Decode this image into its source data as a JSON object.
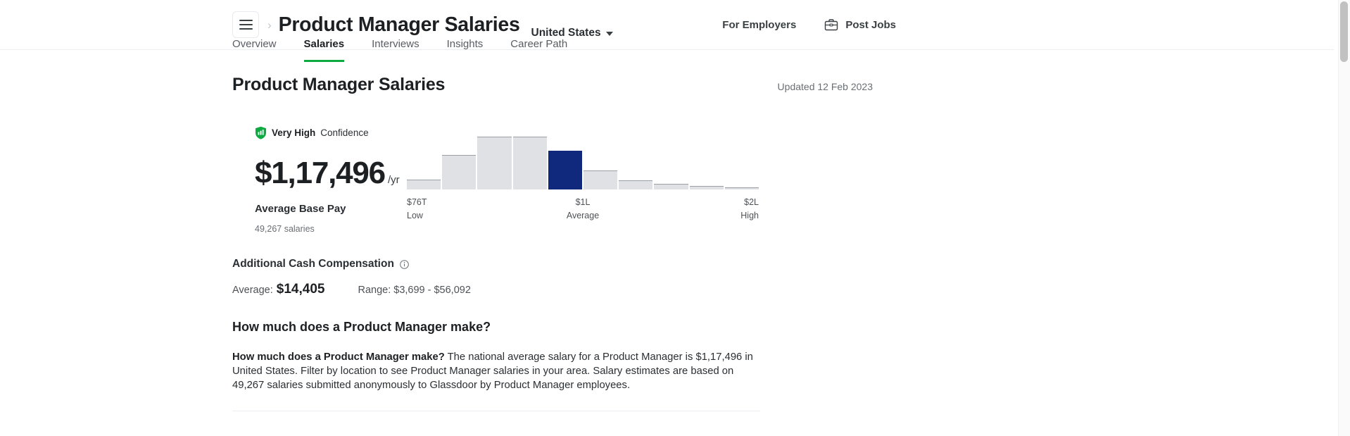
{
  "header": {
    "menu_icon": "hamburger-icon",
    "breadcrumb_chevron": "chevron-right-icon",
    "title": "Product Manager Salaries",
    "location": "United States",
    "location_caret": "chevron-down-icon",
    "for_employers": "For Employers",
    "post_jobs": "Post Jobs",
    "post_jobs_icon": "briefcase-icon"
  },
  "tabs": [
    {
      "label": "Overview",
      "active": false
    },
    {
      "label": "Salaries",
      "active": true
    },
    {
      "label": "Interviews",
      "active": false
    },
    {
      "label": "Insights",
      "active": false
    },
    {
      "label": "Career Path",
      "active": false
    }
  ],
  "main": {
    "section_title": "Product Manager Salaries",
    "updated": "Updated 12 Feb 2023",
    "confidence": {
      "icon": "shield-bars-icon",
      "level": "Very High",
      "suffix": "Confidence"
    },
    "pay": {
      "amount": "$1,17,496",
      "period": "/yr",
      "label": "Average Base Pay",
      "count": "49,267 salaries"
    },
    "cash": {
      "title": "Additional Cash Compensation",
      "info_icon": "info-circle-icon",
      "average_label": "Average:",
      "average_value": "$14,405",
      "range": "Range: $3,699 - $56,092"
    },
    "faq": {
      "heading": "How much does a Product Manager make?",
      "question_inline": "How much does a Product Manager make?",
      "answer": " The national average salary for a Product Manager is $1,17,496 in United States. Filter by location to see Product Manager salaries in your area. Salary estimates are based on 49,267 salaries submitted anonymously to Glassdoor by Product Manager employees."
    }
  },
  "colors": {
    "accent_green": "#0caa41",
    "highlight_bar": "#10297d",
    "bar_grey": "#dfe1e4",
    "bar_top_border": "#9aa0a6"
  },
  "chart_data": {
    "type": "bar",
    "title": "Product Manager base pay distribution",
    "xlabel": "",
    "ylabel": "",
    "grid": false,
    "legend": false,
    "categories": [
      "b1",
      "b2",
      "b3",
      "b4",
      "b5",
      "b6",
      "b7",
      "b8",
      "b9",
      "b10"
    ],
    "values": [
      14,
      48,
      73,
      73,
      54,
      26,
      13,
      8,
      5,
      3
    ],
    "ylim": [
      0,
      80
    ],
    "highlight_index": 4,
    "highlight_color": "#10297d",
    "bar_color": "#dfe1e4",
    "axis_ticks": [
      {
        "value": "$76T",
        "caption": "Low",
        "position": "left"
      },
      {
        "value": "$1L",
        "caption": "Average",
        "position": "center"
      },
      {
        "value": "$2L",
        "caption": "High",
        "position": "right"
      }
    ]
  }
}
